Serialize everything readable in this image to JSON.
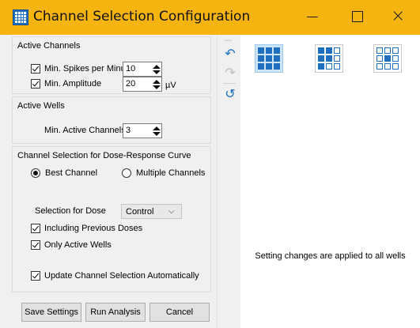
{
  "window": {
    "title": "Channel Selection Configuration",
    "controls": {
      "minimize": "minimize-icon",
      "maximize": "maximize-icon",
      "close": "×"
    }
  },
  "active_channels": {
    "title": "Active Channels",
    "min_spikes_label": "Min. Spikes per Minute",
    "min_spikes_checked": true,
    "min_spikes_value": "10",
    "min_amplitude_label": "Min. Amplitude",
    "min_amplitude_checked": true,
    "min_amplitude_value": "20",
    "amplitude_unit": "µV"
  },
  "active_wells": {
    "title": "Active Wells",
    "min_active_channels_label": "Min. Active Channels",
    "min_active_channels_value": "3"
  },
  "dose_response": {
    "title": "Channel Selection for Dose-Response Curve",
    "best_channel_label": "Best Channel",
    "best_channel_selected": true,
    "multiple_channels_label": "Multiple Channels",
    "multiple_channels_selected": false,
    "selection_for_dose_label": "Selection for Dose",
    "selection_for_dose_value": "Control",
    "including_previous_label": "Including Previous Doses",
    "including_previous_checked": true,
    "only_active_wells_label": "Only Active Wells",
    "only_active_wells_checked": true,
    "update_auto_label": "Update Channel Selection Automatically",
    "update_auto_checked": true
  },
  "buttons": {
    "save": "Save Settings",
    "run": "Run Analysis",
    "cancel": "Cancel"
  },
  "toolbar": {
    "undo_icon": "undo-icon",
    "redo_icon": "redo-icon",
    "reset_icon": "reset-icon"
  },
  "right_panel": {
    "layout_buttons": [
      {
        "icon": "all-filled-grid-icon",
        "active": true
      },
      {
        "icon": "partial-grid-icon",
        "active": false
      },
      {
        "icon": "center-only-grid-icon",
        "active": false
      }
    ],
    "note": "Setting changes are applied to all wells"
  },
  "colors": {
    "title_bar": "#f5b40f",
    "accent": "#1e6fc0",
    "panel_bg": "#f0f0f0"
  }
}
